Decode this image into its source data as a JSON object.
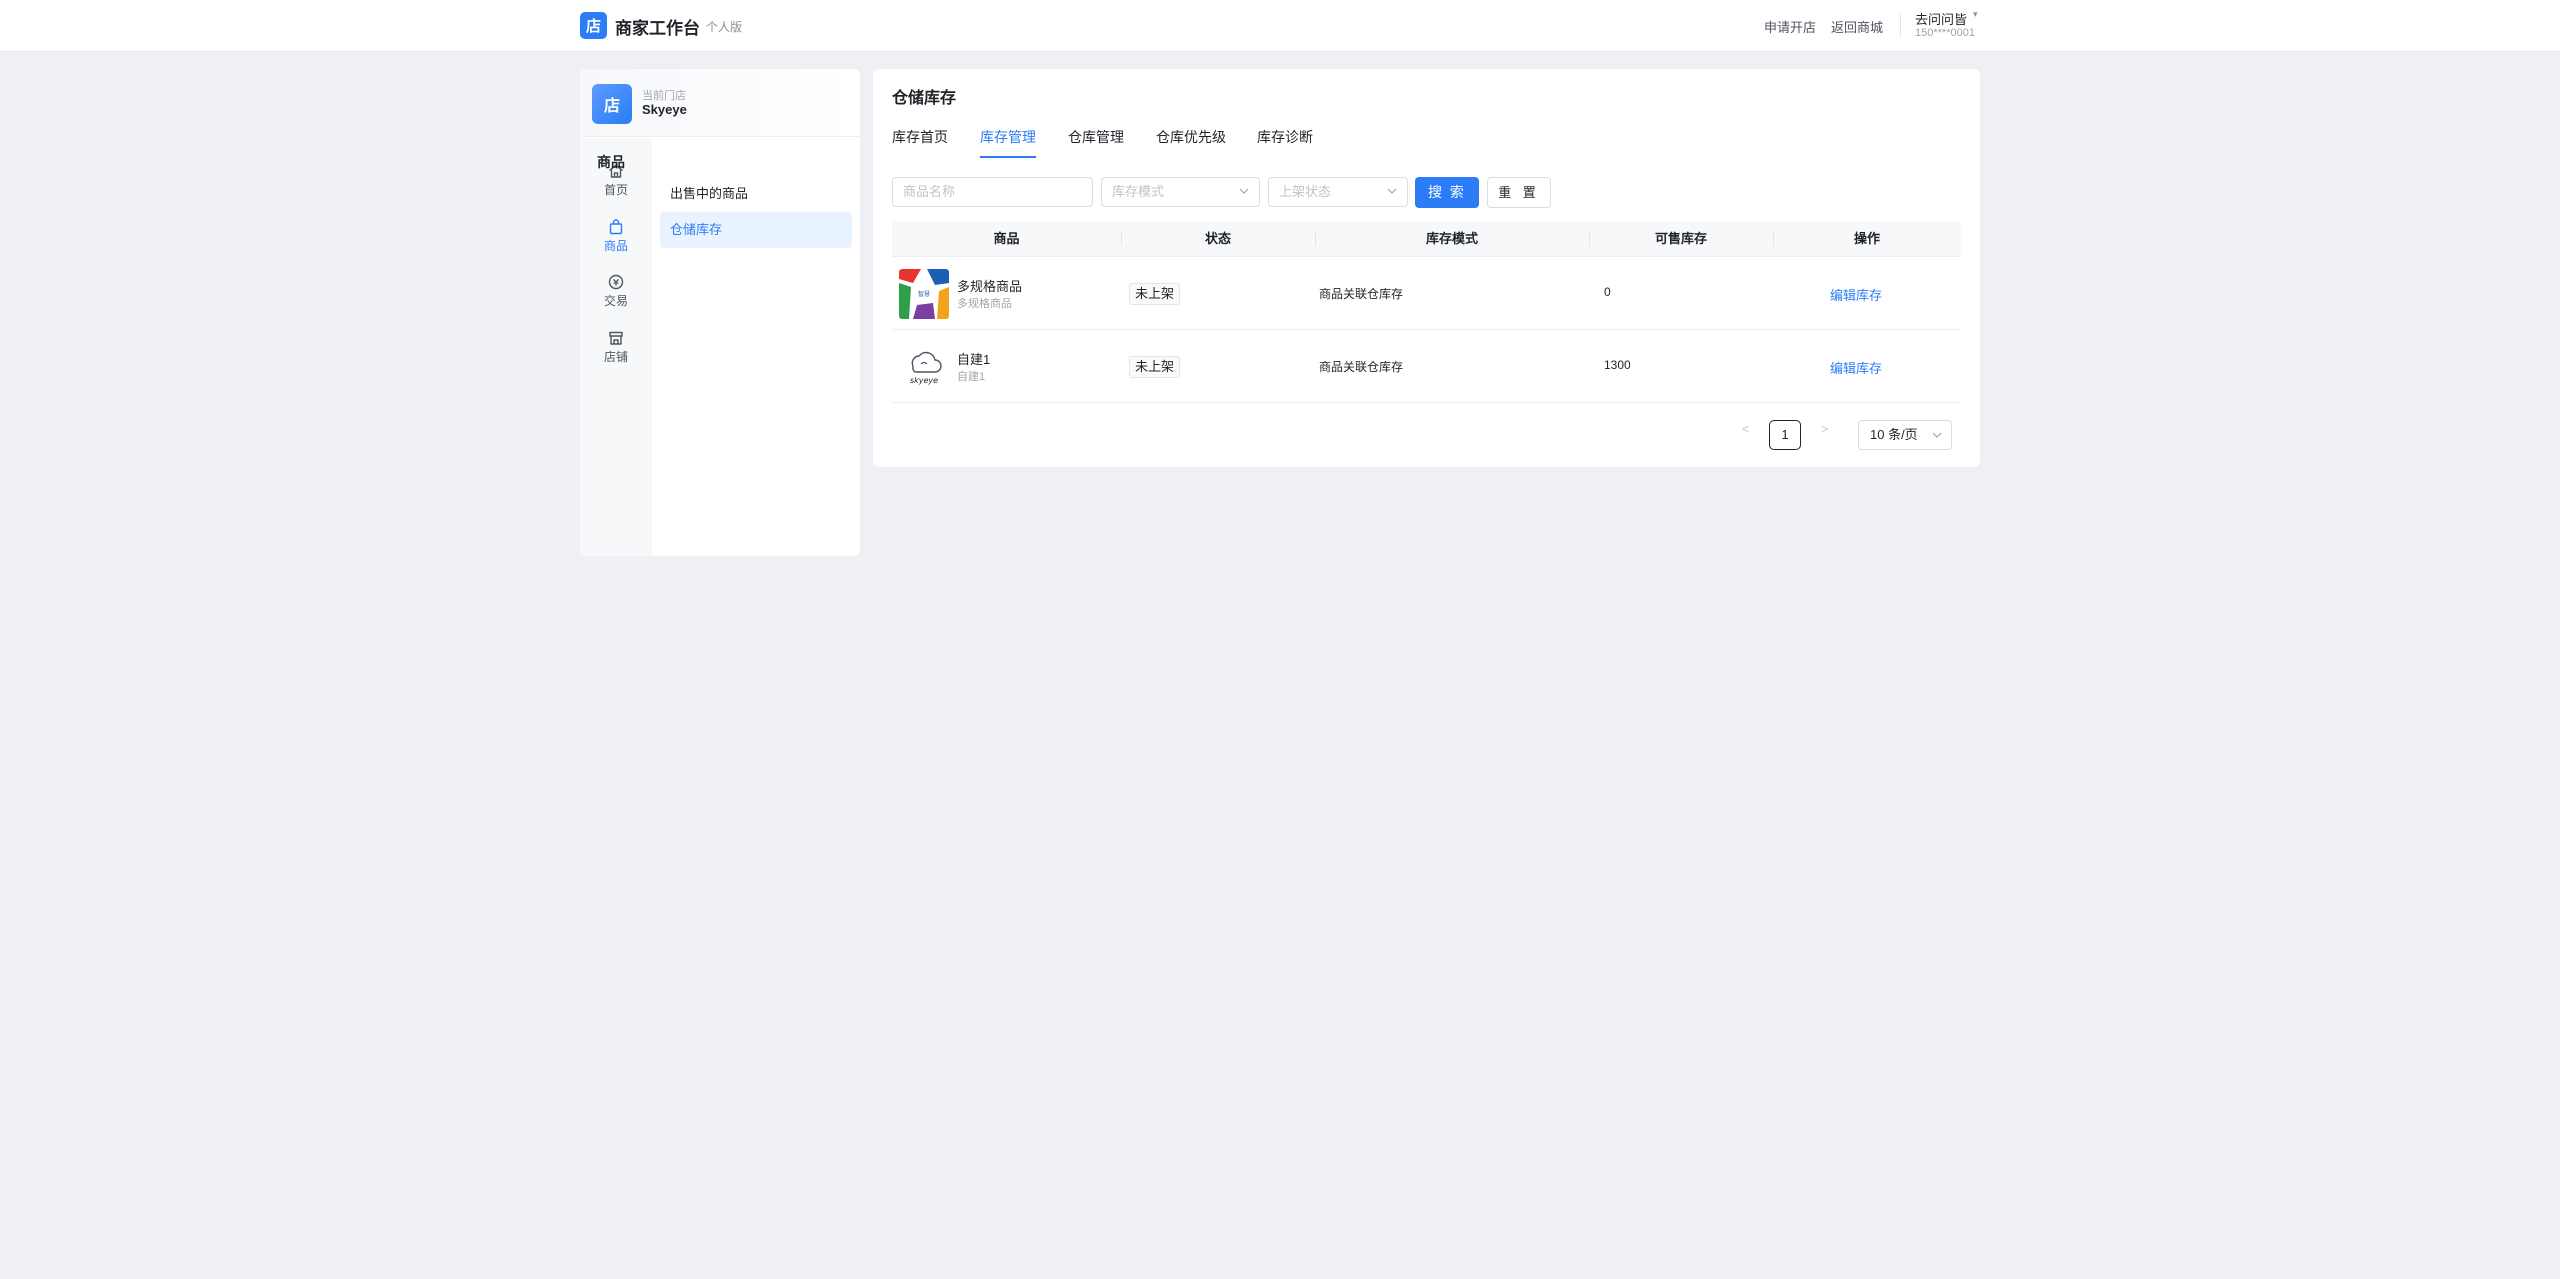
{
  "header": {
    "logo_char": "店",
    "title": "商家工作台",
    "edition": "个人版",
    "links": [
      "申请开店",
      "返回商城"
    ],
    "user_name": "去问问皆",
    "user_phone": "150****0001"
  },
  "store": {
    "avatar_char": "店",
    "caption": "当前门店",
    "name": "Skyeye"
  },
  "side_nav": [
    {
      "label": "首页",
      "icon": "home-icon"
    },
    {
      "label": "商品",
      "icon": "bag-icon",
      "active": true
    },
    {
      "label": "交易",
      "icon": "transaction-icon"
    },
    {
      "label": "店铺",
      "icon": "shop-icon"
    }
  ],
  "sub_menu": {
    "title": "商品",
    "items": [
      "出售中的商品",
      "仓储库存"
    ],
    "active_index": 1
  },
  "main": {
    "title": "仓储库存",
    "tabs": [
      "库存首页",
      "库存管理",
      "仓库管理",
      "仓库优先级",
      "库存诊断"
    ],
    "active_tab": 1,
    "filters": {
      "name_placeholder": "商品名称",
      "mode_placeholder": "库存模式",
      "status_placeholder": "上架状态",
      "search_label": "搜 索",
      "reset_label": "重 置"
    },
    "table": {
      "columns": [
        "商品",
        "状态",
        "库存模式",
        "可售库存",
        "操作"
      ],
      "rows": [
        {
          "name": "多规格商品",
          "sub": "多规格商品",
          "status": "未上架",
          "mode": "商品关联仓库存",
          "stock": "0",
          "action": "编辑库存",
          "thumb": "colorful-logo-thumbnail"
        },
        {
          "name": "自建1",
          "sub": "自建1",
          "status": "未上架",
          "mode": "商品关联仓库存",
          "stock": "1300",
          "action": "编辑库存",
          "thumb": "skyeye-cloud-thumbnail"
        }
      ]
    },
    "pagination": {
      "prev": "<",
      "current": "1",
      "next": ">",
      "page_size": "10 条/页"
    }
  },
  "colors": {
    "accent": "#2b7cf6",
    "background": "#eef0f3",
    "active_bg": "#e8f3ff"
  }
}
